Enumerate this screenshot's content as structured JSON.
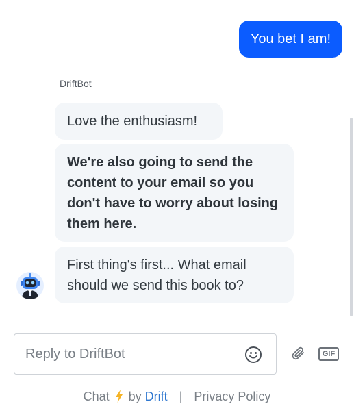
{
  "messages": {
    "user": "You bet I am!",
    "bot_sender": "DriftBot",
    "bot": [
      "Love the enthusiasm!",
      "We're also going to send the content to your email so you don't have to worry about losing them here.",
      "First thing's first... What email should we send this book to?"
    ]
  },
  "composer": {
    "placeholder": "Reply to DriftBot",
    "value": "",
    "gif_label": "GIF"
  },
  "footer": {
    "chat_text": "Chat",
    "by_text": "by",
    "brand": "Drift",
    "separator": "|",
    "privacy": "Privacy Policy"
  },
  "colors": {
    "user_bubble": "#0b5cff",
    "bot_bubble": "#f3f6f9",
    "brand_link": "#2e77d0",
    "bolt": "#f5b324"
  },
  "icons": [
    "robot-avatar-icon",
    "emoji-icon",
    "paperclip-icon",
    "gif-icon",
    "lightning-bolt-icon"
  ]
}
